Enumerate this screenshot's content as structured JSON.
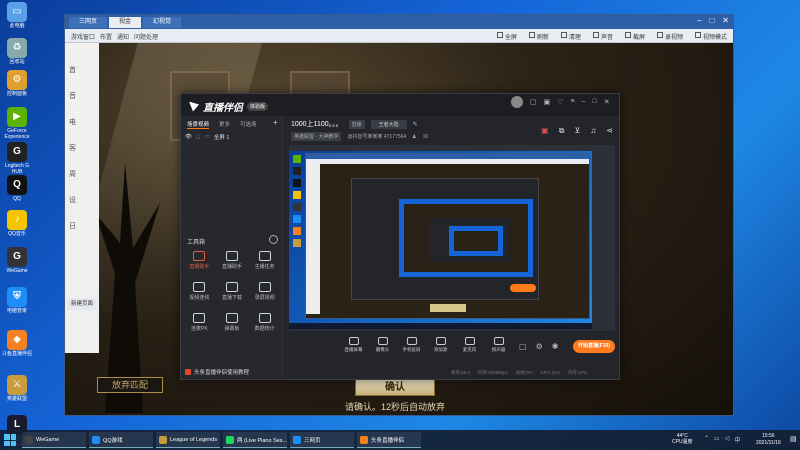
{
  "desktop": {
    "icons": [
      {
        "label": "此电脑",
        "color": "#5aa0e8",
        "glyph": "▭",
        "icon": "computer-icon"
      },
      {
        "label": "回收站",
        "color": "#8aa",
        "glyph": "♻",
        "icon": "recycle-bin-icon"
      },
      {
        "label": "控制面板",
        "color": "#e0a030",
        "glyph": "⚙",
        "icon": "control-panel-icon"
      },
      {
        "label": "GeForce Experience",
        "color": "#5bb300",
        "glyph": "▶",
        "icon": "geforce-icon"
      },
      {
        "label": "Logitech G HUB",
        "color": "#222",
        "glyph": "G",
        "icon": "logitech-icon"
      },
      {
        "label": "QQ",
        "color": "#111",
        "glyph": "Q",
        "icon": "qq-icon"
      },
      {
        "label": "QQ音乐",
        "color": "#f5c400",
        "glyph": "♪",
        "icon": "qq-music-icon"
      },
      {
        "label": "WeGame",
        "color": "#333",
        "glyph": "G",
        "icon": "wegame-icon"
      },
      {
        "label": "电脑管家",
        "color": "#1d8ef5",
        "glyph": "⛨",
        "icon": "pc-manager-icon"
      },
      {
        "label": "斗鱼直播伴侣",
        "color": "#f58220",
        "glyph": "◆",
        "icon": "streaming-app-icon"
      },
      {
        "label": "英雄联盟",
        "color": "#c89b3c",
        "glyph": "⚔",
        "icon": "lol-icon"
      },
      {
        "label": "英雄联盟 WeGame版",
        "color": "#1a1a2e",
        "glyph": "L",
        "icon": "lol-wegame-icon"
      }
    ]
  },
  "browser": {
    "tabs": [
      {
        "label": "三网页",
        "active": false
      },
      {
        "label": "视金",
        "active": true
      },
      {
        "label": "幻视觉",
        "active": false
      }
    ],
    "bookmarks": [
      "游戏窗口",
      "布置",
      "通知",
      "问题处理"
    ],
    "toolbar": [
      "全屏",
      "刷新",
      "清理",
      "声音",
      "截屏",
      "录视频",
      "视频模式"
    ],
    "side_items": [
      "首",
      "音",
      "电",
      "客",
      "周",
      "设",
      "日"
    ],
    "side_button": "新建页面"
  },
  "game": {
    "left_button": "放弃匹配",
    "confirm_button": "确认",
    "message": "请确认。12秒后自动放弃"
  },
  "stream": {
    "logo": "直播伴侣",
    "version": "体验版",
    "room_title": "1000上1100。。。",
    "room_status": "直播",
    "live_category": "王者大陆",
    "room_tag": "英雄联盟 · 大神教学",
    "room_id_text": "@抖音号某某某 47177564",
    "viewer_count": "16",
    "scene_tabs": [
      "场景视频",
      "更多",
      "可选场"
    ],
    "scene_item": "全屏 1",
    "tools_title": "工具箱",
    "tools": [
      {
        "label": "直播助手",
        "color": "#e65c3a",
        "icon": "assistant-icon"
      },
      {
        "label": "直播助手",
        "color": "#cfd3da",
        "icon": "user-icon"
      },
      {
        "label": "主播任务",
        "color": "#cfd3da",
        "icon": "task-icon"
      },
      {
        "label": "视频连线",
        "color": "#cfd3da",
        "icon": "video-link-icon"
      },
      {
        "label": "直播下载",
        "color": "#cfd3da",
        "icon": "download-icon"
      },
      {
        "label": "录屏视频",
        "color": "#cfd3da",
        "icon": "record-icon"
      },
      {
        "label": "连麦PK",
        "color": "#cfd3da",
        "icon": "mic-pk-icon"
      },
      {
        "label": "弹幕板",
        "color": "#cfd3da",
        "icon": "danmaku-icon"
      },
      {
        "label": "数据统计",
        "color": "#cfd3da",
        "icon": "stats-icon"
      }
    ],
    "notice": "头条直播伴侣使用教程",
    "bottom_tools": [
      {
        "label": "直播屏幕",
        "icon": "screen-icon"
      },
      {
        "label": "摄像头",
        "icon": "camera-icon"
      },
      {
        "label": "手机投屏",
        "icon": "phone-icon"
      },
      {
        "label": "添加源",
        "icon": "add-source-icon"
      },
      {
        "label": "麦克风",
        "icon": "mic-icon"
      },
      {
        "label": "扬声器",
        "icon": "speaker-icon"
      }
    ],
    "start_button": "开始直播(F10)",
    "status_bar": [
      "帧率:60.0",
      "码率:6000kbps",
      "丢帧:0%",
      "CPU:11%",
      "内存:37%"
    ]
  },
  "taskbar": {
    "items": [
      {
        "label": "WeGame",
        "color": "#444"
      },
      {
        "label": "QQ游戏",
        "color": "#1d8ef5"
      },
      {
        "label": "League of Legends",
        "color": "#c89b3c"
      },
      {
        "label": "两 (Live Piano Ses...",
        "color": "#1ed760"
      },
      {
        "label": "三网页",
        "color": "#1d8ef5"
      },
      {
        "label": "头条直播伴侣",
        "color": "#f58220"
      }
    ],
    "temperature": "44°C",
    "cpu_label": "CPU温度",
    "time": "15:56",
    "date": "2021/11/19"
  }
}
